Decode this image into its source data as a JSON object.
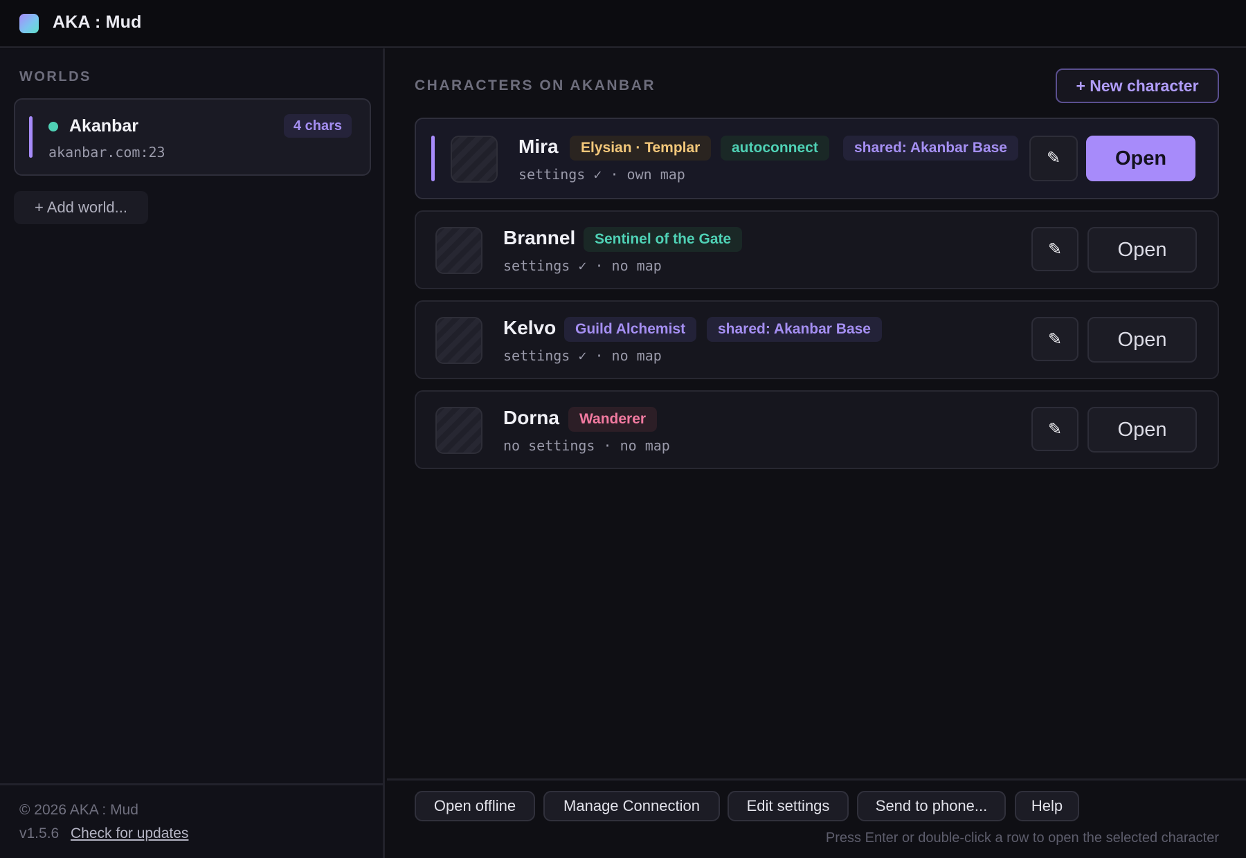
{
  "app": {
    "title": "AKA : Mud"
  },
  "sidebar": {
    "heading": "WORLDS",
    "worlds": [
      {
        "name": "Akanbar",
        "host": "akanbar.com:23",
        "count": "4 chars",
        "status": "online"
      }
    ],
    "add_world_label": "+ Add world...",
    "footer": {
      "copyright": "© 2026 AKA : Mud",
      "version": "v1.5.6",
      "updates_link": "Check for updates"
    }
  },
  "main": {
    "heading": "CHARACTERS ON AKANBAR",
    "new_character_label": "+ New character",
    "characters": [
      {
        "name": "Mira",
        "tags": [
          {
            "label": "Elysian · Templar",
            "color": "#f2c77a"
          },
          {
            "label": "autoconnect",
            "color": "#4fd1b5"
          },
          {
            "label": "shared: Akanbar Base",
            "color": "#a58ff2"
          }
        ],
        "meta": "settings ✓ · own map",
        "edit_icon": "✎",
        "open_label": "Open",
        "selected": true
      },
      {
        "name": "Brannel",
        "tags": [
          {
            "label": "Sentinel of the Gate",
            "color": "#4fd1b5"
          }
        ],
        "meta": "settings ✓ · no map",
        "edit_icon": "✎",
        "open_label": "Open",
        "selected": false
      },
      {
        "name": "Kelvo",
        "tags": [
          {
            "label": "Guild Alchemist",
            "color": "#a58ff2"
          },
          {
            "label": "shared: Akanbar Base",
            "color": "#a58ff2"
          }
        ],
        "meta": "settings ✓ · no map",
        "edit_icon": "✎",
        "open_label": "Open",
        "selected": false
      },
      {
        "name": "Dorna",
        "tags": [
          {
            "label": "Wanderer",
            "color": "#f27aa0"
          }
        ],
        "meta": "no settings · no map",
        "edit_icon": "✎",
        "open_label": "Open",
        "selected": false
      }
    ]
  },
  "bottombar": {
    "buttons": [
      "Open offline",
      "Manage Connection",
      "Edit settings",
      "Send to phone...",
      "Help"
    ],
    "hint": "Press Enter or double-click a row to open the selected character"
  },
  "colors": {
    "accent": "#a78bfa",
    "online": "#4fd1b5",
    "background": "#0f0f14"
  }
}
